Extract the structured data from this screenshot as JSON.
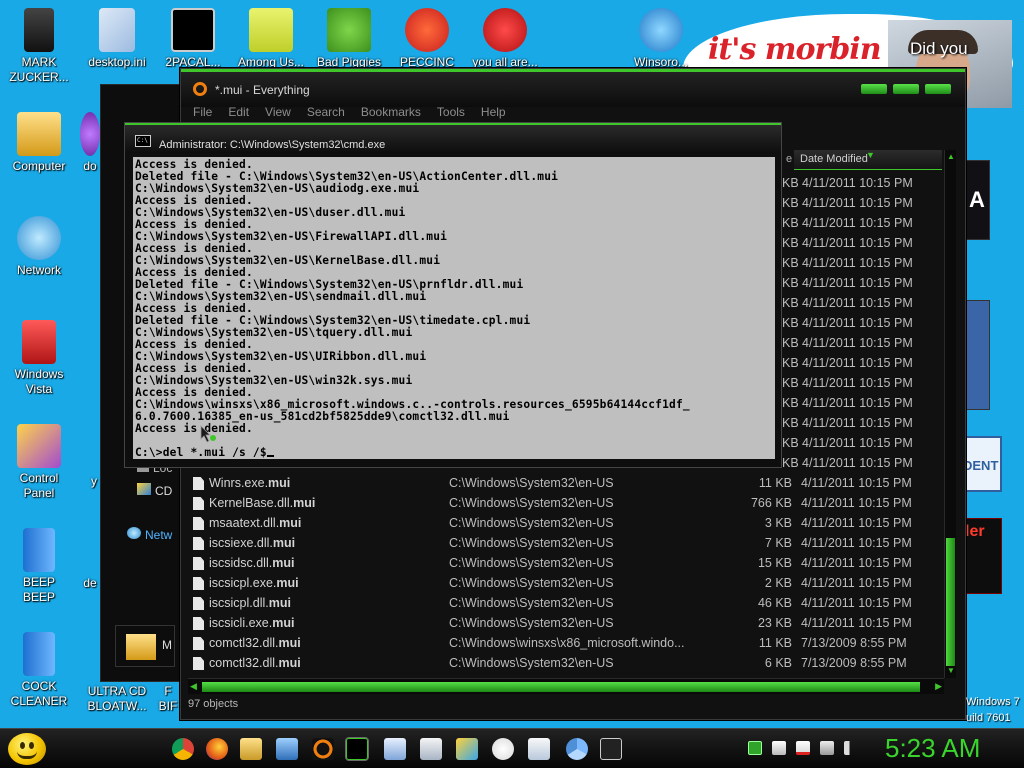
{
  "desktop": {
    "icons": [
      {
        "label": "MARK\nZUCKER..."
      },
      {
        "label": "desktop.ini"
      },
      {
        "label": "2PACAL..."
      },
      {
        "label": "Among Us..."
      },
      {
        "label": "Bad Piggies"
      },
      {
        "label": "PECCINC"
      },
      {
        "label": "you all are..."
      },
      {
        "label": "Winsoro..."
      },
      {
        "label": "Computer"
      },
      {
        "label": "Network"
      },
      {
        "label": "Windows\nVista"
      },
      {
        "label": "Control\nPanel"
      },
      {
        "label": "BEEP\nBEEP"
      },
      {
        "label": "COCK\nCLEANER"
      },
      {
        "label": "ULTRA CD\nBLOATW..."
      },
      {
        "label": "F\nBIF"
      },
      {
        "label": "do"
      },
      {
        "label": "de"
      },
      {
        "label": "y"
      }
    ],
    "banner_text": "it's morbin ti",
    "photo_caption": "Did you",
    "right_widget_text": "DENT",
    "right_widget_text2": "ler",
    "right_widget_text3": "A",
    "watermark": {
      "line1": "Windows 7",
      "line2": "uild 7601"
    }
  },
  "bg_window": {
    "items": [
      {
        "label": "Loc"
      },
      {
        "label": "CD"
      },
      {
        "label": "Netw"
      },
      {
        "label": "M"
      }
    ]
  },
  "everything": {
    "title": "*.mui - Everything",
    "menu": [
      "File",
      "Edit",
      "View",
      "Search",
      "Bookmarks",
      "Tools",
      "Help"
    ],
    "header": {
      "size_frag": "e",
      "date_modified": "Date Modified"
    },
    "upper_rows": [
      {
        "size": "KB",
        "date": "4/11/2011 10:15 PM"
      },
      {
        "size": "KB",
        "date": "4/11/2011 10:15 PM"
      },
      {
        "size": "KB",
        "date": "4/11/2011 10:15 PM"
      },
      {
        "size": "KB",
        "date": "4/11/2011 10:15 PM"
      },
      {
        "size": "KB",
        "date": "4/11/2011 10:15 PM"
      },
      {
        "size": "KB",
        "date": "4/11/2011 10:15 PM"
      },
      {
        "size": "KB",
        "date": "4/11/2011 10:15 PM"
      },
      {
        "size": "KB",
        "date": "4/11/2011 10:15 PM"
      },
      {
        "size": "KB",
        "date": "4/11/2011 10:15 PM"
      },
      {
        "size": "KB",
        "date": "4/11/2011 10:15 PM"
      },
      {
        "size": "KB",
        "date": "4/11/2011 10:15 PM"
      },
      {
        "size": "KB",
        "date": "4/11/2011 10:15 PM"
      },
      {
        "size": "KB",
        "date": "4/11/2011 10:15 PM"
      },
      {
        "size": "KB",
        "date": "4/11/2011 10:15 PM"
      },
      {
        "size": "KB",
        "date": "4/11/2011 10:15 PM"
      }
    ],
    "rows": [
      {
        "name": "Winrs.exe.",
        "ext": "mui",
        "path": "C:\\Windows\\System32\\en-US",
        "size": "11 KB",
        "date": "4/11/2011 10:15 PM"
      },
      {
        "name": "KernelBase.dll.",
        "ext": "mui",
        "path": "C:\\Windows\\System32\\en-US",
        "size": "766 KB",
        "date": "4/11/2011 10:15 PM"
      },
      {
        "name": "msaatext.dll.",
        "ext": "mui",
        "path": "C:\\Windows\\System32\\en-US",
        "size": "3 KB",
        "date": "4/11/2011 10:15 PM"
      },
      {
        "name": "iscsiexe.dll.",
        "ext": "mui",
        "path": "C:\\Windows\\System32\\en-US",
        "size": "7 KB",
        "date": "4/11/2011 10:15 PM"
      },
      {
        "name": "iscsidsc.dll.",
        "ext": "mui",
        "path": "C:\\Windows\\System32\\en-US",
        "size": "15 KB",
        "date": "4/11/2011 10:15 PM"
      },
      {
        "name": "iscsicpl.exe.",
        "ext": "mui",
        "path": "C:\\Windows\\System32\\en-US",
        "size": "2 KB",
        "date": "4/11/2011 10:15 PM"
      },
      {
        "name": "iscsicpl.dll.",
        "ext": "mui",
        "path": "C:\\Windows\\System32\\en-US",
        "size": "46 KB",
        "date": "4/11/2011 10:15 PM"
      },
      {
        "name": "iscsicli.exe.",
        "ext": "mui",
        "path": "C:\\Windows\\System32\\en-US",
        "size": "23 KB",
        "date": "4/11/2011 10:15 PM"
      },
      {
        "name": "comctl32.dll.",
        "ext": "mui",
        "path": "C:\\Windows\\winsxs\\x86_microsoft.windo...",
        "size": "11 KB",
        "date": "7/13/2009 8:55 PM"
      },
      {
        "name": "comctl32.dll.",
        "ext": "mui",
        "path": "C:\\Windows\\System32\\en-US",
        "size": "6 KB",
        "date": "7/13/2009 8:55 PM"
      }
    ],
    "status": "97 objects"
  },
  "cmd": {
    "title": "Administrator: C:\\Windows\\System32\\cmd.exe",
    "lines": [
      "Access is denied.",
      "Deleted file - C:\\Windows\\System32\\en-US\\ActionCenter.dll.mui",
      "C:\\Windows\\System32\\en-US\\audiodg.exe.mui",
      "Access is denied.",
      "C:\\Windows\\System32\\en-US\\duser.dll.mui",
      "Access is denied.",
      "C:\\Windows\\System32\\en-US\\FirewallAPI.dll.mui",
      "Access is denied.",
      "C:\\Windows\\System32\\en-US\\KernelBase.dll.mui",
      "Access is denied.",
      "Deleted file - C:\\Windows\\System32\\en-US\\prnfldr.dll.mui",
      "C:\\Windows\\System32\\en-US\\sendmail.dll.mui",
      "Access is denied.",
      "Deleted file - C:\\Windows\\System32\\en-US\\timedate.cpl.mui",
      "C:\\Windows\\System32\\en-US\\tquery.dll.mui",
      "Access is denied.",
      "C:\\Windows\\System32\\en-US\\UIRibbon.dll.mui",
      "Access is denied.",
      "C:\\Windows\\System32\\en-US\\win32k.sys.mui",
      "Access is denied.",
      "C:\\Windows\\winsxs\\x86_microsoft.windows.c..-controls.resources_6595b64144ccf1df_",
      "6.0.7600.16385_en-us_581cd2bf5825dde9\\comctl32.dll.mui",
      "Access is denied.",
      "",
      "C:\\>del *.mui /s /$"
    ]
  },
  "taskbar": {
    "clock": "5:23 AM",
    "items": [
      "chrome-icon",
      "firefox-icon",
      "explorer-icon",
      "remote-desktop-icon",
      "everything-icon",
      "cmd-icon",
      "notepad-icon",
      "calculator-icon",
      "photos-icon",
      "paint-icon",
      "document-icon",
      "chromium-icon",
      "7zip-icon"
    ],
    "tray": [
      "cpu-icon",
      "printer-icon",
      "action-center-icon",
      "network-icon",
      "volume-icon"
    ],
    "active_color": "#3fc62a"
  },
  "colors": {
    "desktop": "#19a9e6",
    "accent": "#3fc62a",
    "clock": "#39d42c"
  }
}
